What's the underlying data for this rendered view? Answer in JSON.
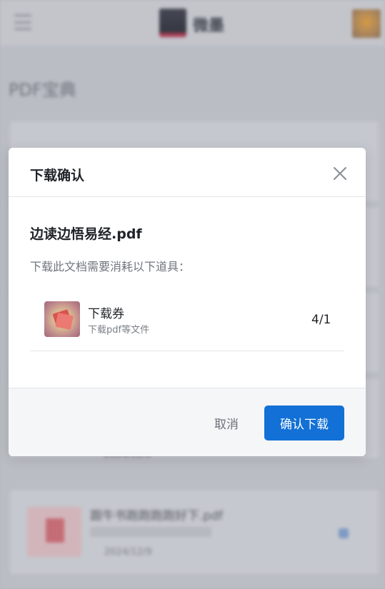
{
  "background": {
    "brand": {
      "name": "微墨"
    },
    "page_title": "PDF宝典",
    "cards": [
      {
        "title": ""
      },
      {
        "title": ""
      },
      {
        "title": ""
      },
      {
        "title": "",
        "date": "2024/12/9"
      },
      {
        "title": "跟牛书跑跑跑跑好下.pdf",
        "date": "2024/12/9"
      }
    ]
  },
  "modal": {
    "title": "下载确认",
    "file_name": "边读边悟易经.pdf",
    "prompt": "下载此文档需要消耗以下道具：",
    "item": {
      "name": "下载券",
      "description": "下载pdf等文件",
      "count": "4/1",
      "icon": "ticket-icon"
    },
    "cancel_label": "取消",
    "confirm_label": "确认下载"
  },
  "colors": {
    "primary": "#1270d6",
    "overlay": "#c3c6cc",
    "text": "#1f2329",
    "muted": "#70757e"
  }
}
